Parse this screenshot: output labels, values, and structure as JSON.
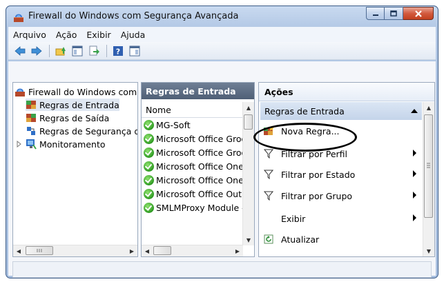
{
  "window": {
    "title": "Firewall do Windows com Segurança Avançada",
    "controls": {
      "minimize": "minimize",
      "maximize": "maximize",
      "close": "close"
    }
  },
  "menu": [
    "Arquivo",
    "Ação",
    "Exibir",
    "Ajuda"
  ],
  "toolbar": {
    "icons": [
      "back-icon",
      "forward-icon",
      "up-folder-icon",
      "show-hide-console-tree-icon",
      "export-icon",
      "help-icon",
      "show-hide-action-pane-icon"
    ]
  },
  "tree": {
    "root": "Firewall do Windows com S",
    "items": [
      {
        "label": "Regras de Entrada",
        "selected": true
      },
      {
        "label": "Regras de Saída"
      },
      {
        "label": "Regras de Segurança de"
      },
      {
        "label": "Monitoramento"
      }
    ]
  },
  "rules": {
    "header": "Regras de Entrada",
    "column": "Nome",
    "rows": [
      "MG-Soft",
      "Microsoft Office Groove",
      "Microsoft Office Groove",
      "Microsoft Office OneNo",
      "Microsoft Office OneNo",
      "Microsoft Office Outloo",
      "SMLMProxy Module - F"
    ]
  },
  "actions": {
    "title": "Ações",
    "section": "Regras de Entrada",
    "items": [
      {
        "label": "Nova Regra...",
        "icon": "new-rule-icon",
        "submenu": false
      },
      {
        "label": "Filtrar por Perfil",
        "icon": "filter-icon",
        "submenu": true
      },
      {
        "label": "Filtrar por Estado",
        "icon": "filter-icon",
        "submenu": true
      },
      {
        "label": "Filtrar por Grupo",
        "icon": "filter-icon",
        "submenu": true
      },
      {
        "label": "Exibir",
        "icon": "",
        "submenu": true
      },
      {
        "label": "Atualizar",
        "icon": "refresh-icon",
        "submenu": false
      }
    ]
  },
  "colors": {
    "pane_header": "#4f5f76",
    "section_bg": "#c4d4ea",
    "close_button": "#c2401f",
    "enabled_rule": "#2f9b23"
  }
}
